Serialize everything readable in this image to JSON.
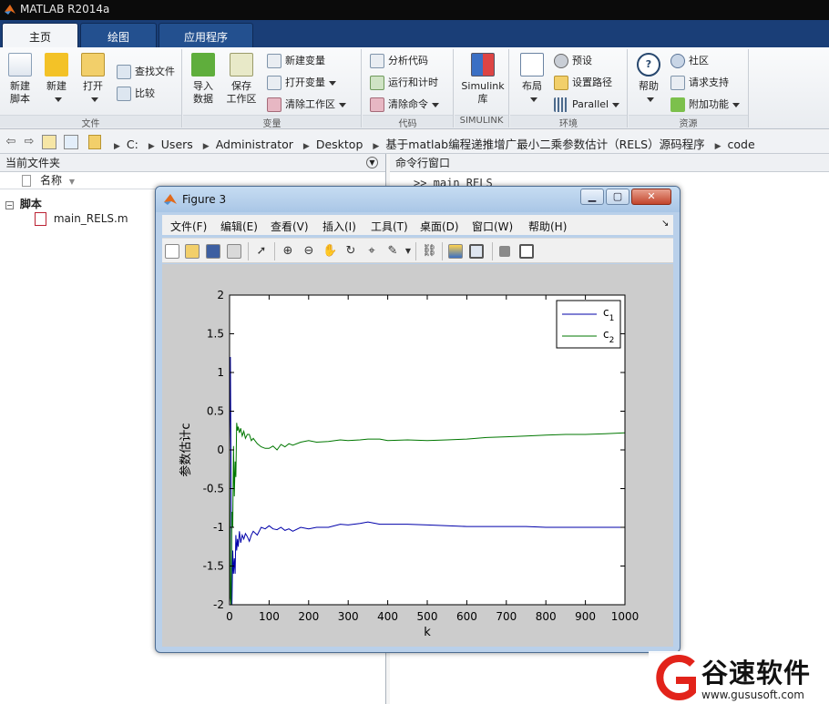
{
  "app": {
    "title": "MATLAB R2014a"
  },
  "tabs": [
    {
      "label": "主页",
      "active": true
    },
    {
      "label": "绘图",
      "active": false
    },
    {
      "label": "应用程序",
      "active": false
    }
  ],
  "ribbon": {
    "groups": {
      "file": "文件",
      "variable": "变量",
      "code": "代码",
      "simulink": "SIMULINK",
      "environment": "环境",
      "resources": "资源"
    },
    "new_script": "新建\n脚本",
    "new": "新建",
    "open": "打开",
    "find_files": "查找文件",
    "compare": "比较",
    "import_data": "导入\n数据",
    "save_workspace": "保存\n工作区",
    "new_variable": "新建变量",
    "open_variable": "打开变量",
    "clear_workspace": "清除工作区",
    "analyze_code": "分析代码",
    "run_and_time": "运行和计时",
    "clear_commands": "清除命令",
    "simulink_library": "Simulink\n库",
    "layout": "布局",
    "preferences": "预设",
    "set_path": "设置路径",
    "parallel": "Parallel",
    "help": "帮助",
    "community": "社区",
    "request_support": "请求支持",
    "add_ons": "附加功能"
  },
  "address": {
    "path": [
      "C:",
      "Users",
      "Administrator",
      "Desktop",
      "基于matlab编程递推增广最小二乘参数估计（RELS）源码程序",
      "code"
    ]
  },
  "left_panel": {
    "title": "当前文件夹",
    "column_name": "名称",
    "group": "脚本",
    "files": [
      "main_RELS.m"
    ]
  },
  "right_panel": {
    "title": "命令行窗口",
    "command": ">> main_RELS"
  },
  "figure": {
    "title": "Figure 3",
    "menu": [
      "文件(F)",
      "编辑(E)",
      "查看(V)",
      "插入(I)",
      "工具(T)",
      "桌面(D)",
      "窗口(W)",
      "帮助(H)"
    ]
  },
  "colors": {
    "c1": "#0000aa",
    "c2": "#007700"
  },
  "chart_data": {
    "type": "line",
    "title": "",
    "xlabel": "k",
    "ylabel": "参数估计c",
    "xlim": [
      0,
      1000
    ],
    "ylim": [
      -2,
      2
    ],
    "xticks": [
      0,
      100,
      200,
      300,
      400,
      500,
      600,
      700,
      800,
      900,
      1000
    ],
    "yticks": [
      -2,
      -1.5,
      -1,
      -0.5,
      0,
      0.5,
      1,
      1.5,
      2
    ],
    "ytick_labels": [
      "-2",
      "-1.5",
      "-1",
      "-0.5",
      "0",
      "0.5",
      "1",
      "1.5",
      "2"
    ],
    "legend_position": "top-right",
    "grid": false,
    "series": [
      {
        "name": "c1",
        "legend_main": "c",
        "legend_sub": "1",
        "color": "#0000aa",
        "x": [
          0,
          2,
          4,
          6,
          8,
          10,
          12,
          14,
          16,
          18,
          20,
          22,
          25,
          28,
          32,
          36,
          40,
          45,
          50,
          55,
          60,
          70,
          80,
          90,
          100,
          110,
          120,
          130,
          140,
          150,
          160,
          180,
          200,
          220,
          250,
          280,
          300,
          330,
          350,
          380,
          400,
          450,
          500,
          550,
          600,
          650,
          700,
          750,
          800,
          850,
          900,
          950,
          1000
        ],
        "y": [
          0,
          1.2,
          -0.5,
          -2.0,
          -1.3,
          -1.6,
          -1.4,
          -1.6,
          -1.1,
          -1.3,
          -1.15,
          -1.25,
          -1.05,
          -1.2,
          -1.1,
          -1.15,
          -1.08,
          -1.12,
          -1.18,
          -1.1,
          -1.05,
          -1.1,
          -1.0,
          -1.02,
          -0.98,
          -1.02,
          -1.03,
          -1.0,
          -1.04,
          -1.02,
          -1.05,
          -1.0,
          -1.02,
          -1.0,
          -1.0,
          -0.96,
          -0.97,
          -0.95,
          -0.93,
          -0.96,
          -0.96,
          -0.96,
          -0.97,
          -0.98,
          -0.99,
          -0.99,
          -0.99,
          -0.99,
          -1.0,
          -1.0,
          -1.0,
          -1.0,
          -1.0
        ]
      },
      {
        "name": "c2",
        "legend_main": "c",
        "legend_sub": "2",
        "color": "#007700",
        "x": [
          0,
          2,
          4,
          6,
          8,
          10,
          12,
          14,
          16,
          18,
          20,
          22,
          25,
          28,
          32,
          36,
          40,
          45,
          50,
          55,
          60,
          70,
          80,
          90,
          100,
          110,
          120,
          130,
          140,
          150,
          160,
          180,
          200,
          220,
          250,
          280,
          300,
          330,
          350,
          380,
          400,
          450,
          500,
          550,
          600,
          650,
          700,
          750,
          800,
          850,
          900,
          950,
          1000
        ],
        "y": [
          0,
          -1.9,
          -2.0,
          -0.8,
          -1.0,
          0.05,
          -0.6,
          -0.15,
          -0.35,
          0.35,
          0.25,
          0.3,
          0.22,
          0.28,
          0.18,
          0.24,
          0.15,
          0.2,
          0.2,
          0.12,
          0.15,
          0.08,
          0.04,
          0.02,
          0.02,
          0.05,
          0.0,
          0.07,
          0.04,
          0.08,
          0.06,
          0.1,
          0.12,
          0.1,
          0.11,
          0.13,
          0.12,
          0.13,
          0.14,
          0.14,
          0.12,
          0.13,
          0.12,
          0.13,
          0.14,
          0.16,
          0.17,
          0.18,
          0.19,
          0.2,
          0.2,
          0.21,
          0.22
        ]
      }
    ]
  },
  "watermark": {
    "brand": "谷速软件",
    "url": "www.gususoft.com"
  }
}
